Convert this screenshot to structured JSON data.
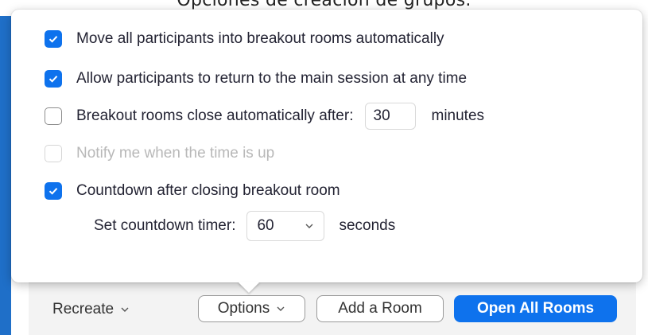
{
  "caption": "Opciones de creación de grupos.",
  "options": {
    "move_all": {
      "label": "Move all participants into breakout rooms automatically",
      "checked": true
    },
    "allow_return": {
      "label": "Allow participants to return to the main session at any time",
      "checked": true
    },
    "auto_close": {
      "label": "Breakout rooms close automatically after:",
      "checked": false,
      "value": "30",
      "unit": "minutes"
    },
    "notify": {
      "label": "Notify me when the time is up",
      "checked": false,
      "disabled": true
    },
    "countdown": {
      "label": "Countdown after closing breakout room",
      "checked": true
    },
    "countdown_timer": {
      "label": "Set countdown timer:",
      "value": "60",
      "unit": "seconds"
    }
  },
  "toolbar": {
    "recreate_label": "Recreate",
    "options_label": "Options",
    "add_room_label": "Add a Room",
    "open_all_label": "Open All Rooms"
  },
  "colors": {
    "accent": "#0e72ed",
    "desktop_blue": "#1f6fc8"
  },
  "icons": {
    "checkbox_checked": "checkmark-icon",
    "dropdown": "chevron-down-icon"
  }
}
